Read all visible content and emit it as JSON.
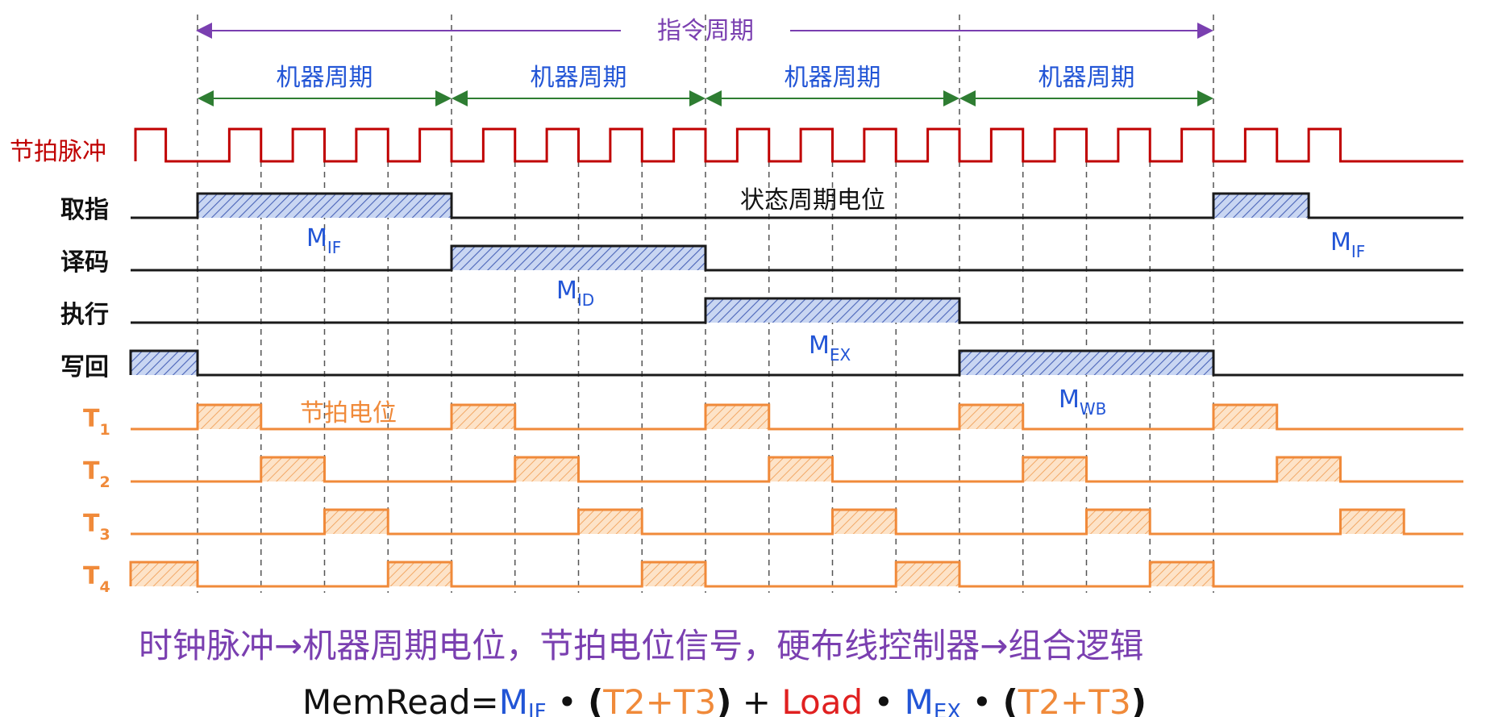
{
  "instruction_cycle_label": "指令周期",
  "machine_cycle_labels": [
    "机器周期",
    "机器周期",
    "机器周期",
    "机器周期"
  ],
  "clock_label": "节拍脉冲",
  "state_signals": [
    {
      "label": "取指"
    },
    {
      "label": "译码"
    },
    {
      "label": "执行"
    },
    {
      "label": "写回"
    }
  ],
  "t_signals": [
    {
      "main": "T",
      "sub": "1"
    },
    {
      "main": "T",
      "sub": "2"
    },
    {
      "main": "T",
      "sub": "3"
    },
    {
      "main": "T",
      "sub": "4"
    }
  ],
  "m_labels": [
    {
      "main": "M",
      "sub": "IF"
    },
    {
      "main": "M",
      "sub": "ID"
    },
    {
      "main": "M",
      "sub": "EX"
    },
    {
      "main": "M",
      "sub": "WB"
    },
    {
      "main": "M",
      "sub": "IF"
    }
  ],
  "state_note": "状态周期电位",
  "beat_note": "节拍电位",
  "bottom_note": "时钟脉冲→机器周期电位，节拍电位信号，硬布线控制器→组合逻辑",
  "formula": {
    "p1": "MemRead=",
    "m1_main": "M",
    "m1_sub": "IF",
    "p2": " • ",
    "p3": "(",
    "t1": "T2+T3",
    "p4": ")",
    "p5": " + ",
    "load": "Load",
    "p6": " • ",
    "m2_main": "M",
    "m2_sub": "EX",
    "p7": " • ",
    "p8": "(",
    "t2": "T2+T3",
    "p9": ")"
  },
  "colors": {
    "clock": "#c00000",
    "state": "#1a1a1a",
    "state_fill": "#c9d6f2",
    "state_hatch": "#4a64b8",
    "t_line": "#f08a3a",
    "t_fill": "#fde3c8",
    "cycle_arrow": "#2e7d32",
    "instruction_arrow": "#7a3fb0",
    "label_blue": "#2255d6",
    "formula_orange": "#f08a3a",
    "formula_red": "#e02020"
  }
}
